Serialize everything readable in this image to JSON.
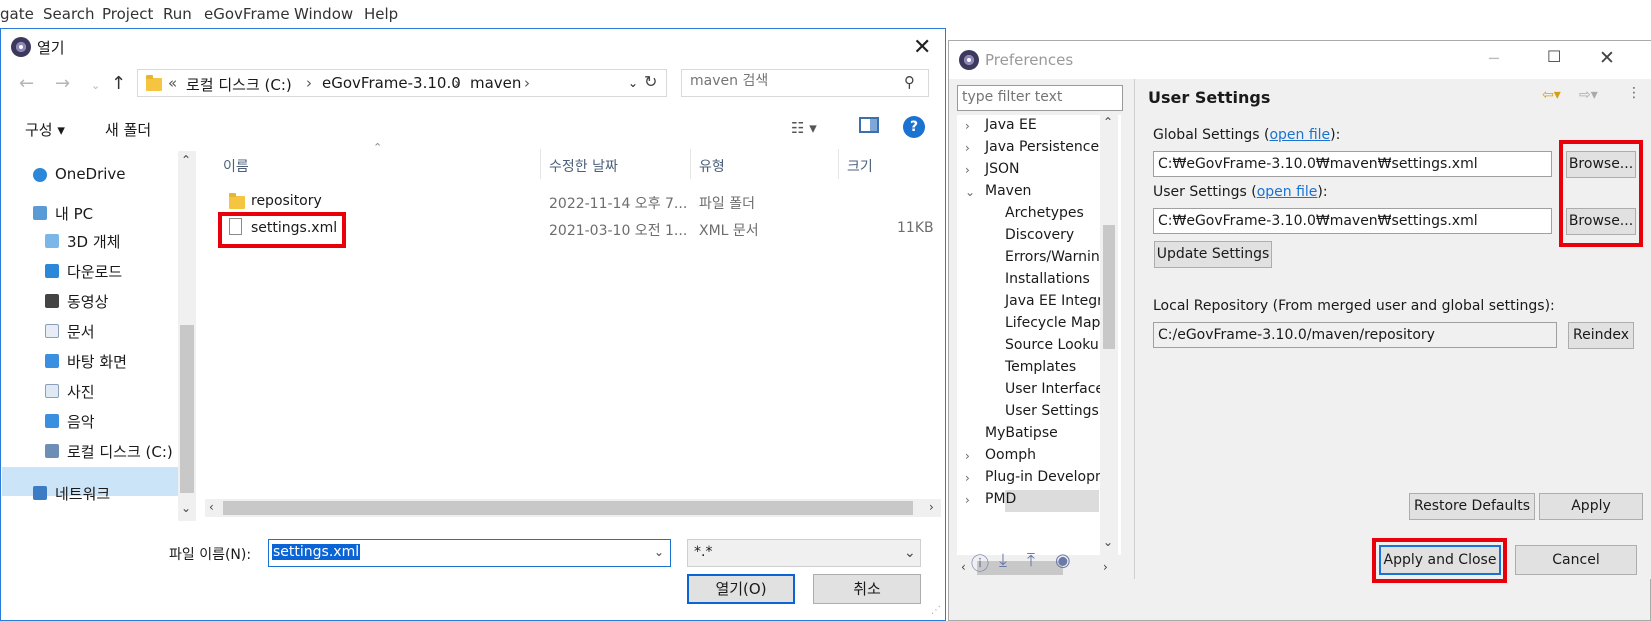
{
  "menubar": {
    "items": [
      "gate",
      "Search",
      "Project",
      "Run",
      "eGovFrame",
      "Window",
      "Help"
    ]
  },
  "open_dialog": {
    "title": "열기",
    "address": {
      "prefix": "«",
      "segments": [
        "로컬 디스크 (C:)",
        "eGovFrame-3.10.0",
        "maven"
      ]
    },
    "search_placeholder": "maven 검색",
    "toolbar": {
      "organize": "구성",
      "new_folder": "새 폴더"
    },
    "nav": {
      "items": [
        "OneDrive",
        "내 PC",
        "3D 개체",
        "다운로드",
        "동영상",
        "문서",
        "바탕 화면",
        "사진",
        "음악",
        "로컬 디스크 (C:)",
        "네트워크"
      ]
    },
    "columns": [
      "이름",
      "수정한 날짜",
      "유형",
      "크기"
    ],
    "files": [
      {
        "name": "repository",
        "date": "2022-11-14 오후 7...",
        "type": "파일 폴더",
        "size": ""
      },
      {
        "name": "settings.xml",
        "date": "2021-03-10 오전 1...",
        "type": "XML 문서",
        "size": "11KB"
      }
    ],
    "filename_label": "파일 이름(N):",
    "filename_value": "settings.xml",
    "filter_value": "*.*",
    "open_button": "열기(O)",
    "cancel_button": "취소"
  },
  "preferences": {
    "title": "Preferences",
    "filter_placeholder": "type filter text",
    "tree": [
      {
        "label": "Java EE",
        "level": 0,
        "arrow": ">"
      },
      {
        "label": "Java Persistence",
        "level": 0,
        "arrow": ">"
      },
      {
        "label": "JSON",
        "level": 0,
        "arrow": ">"
      },
      {
        "label": "Maven",
        "level": 0,
        "arrow": "v"
      },
      {
        "label": "Archetypes",
        "level": 1,
        "arrow": ""
      },
      {
        "label": "Discovery",
        "level": 1,
        "arrow": ""
      },
      {
        "label": "Errors/Warning",
        "level": 1,
        "arrow": ""
      },
      {
        "label": "Installations",
        "level": 1,
        "arrow": ""
      },
      {
        "label": "Java EE Integra",
        "level": 1,
        "arrow": ""
      },
      {
        "label": "Lifecycle Mapp",
        "level": 1,
        "arrow": ""
      },
      {
        "label": "Source Lookup",
        "level": 1,
        "arrow": ""
      },
      {
        "label": "Templates",
        "level": 1,
        "arrow": ""
      },
      {
        "label": "User Interface",
        "level": 1,
        "arrow": ""
      },
      {
        "label": "User Settings",
        "level": 1,
        "arrow": ""
      },
      {
        "label": "MyBatipse",
        "level": 0,
        "arrow": ""
      },
      {
        "label": "Oomph",
        "level": 0,
        "arrow": ">"
      },
      {
        "label": "Plug-in Developm",
        "level": 0,
        "arrow": ">"
      },
      {
        "label": "PMD",
        "level": 0,
        "arrow": ">"
      }
    ],
    "page_title": "User Settings",
    "global_label": "Global Settings (",
    "global_link": "open file",
    "global_suffix": "):",
    "global_path": "C:₩eGovFrame-3.10.0₩maven₩settings.xml",
    "user_label": "User Settings (",
    "user_link": "open file",
    "user_suffix": "):",
    "user_path": "C:₩eGovFrame-3.10.0₩maven₩settings.xml",
    "browse_button": "Browse...",
    "update_button": "Update Settings",
    "local_repo_label": "Local Repository (From merged user and global settings):",
    "local_repo_path": "C:/eGovFrame-3.10.0/maven/repository",
    "reindex_button": "Reindex",
    "restore_defaults": "Restore Defaults",
    "apply": "Apply",
    "apply_and_close": "Apply and Close",
    "cancel": "Cancel"
  },
  "colors": {
    "highlight_red": "#e8000b",
    "selection_blue": "#0a64d6",
    "link_blue": "#1a73d1"
  }
}
